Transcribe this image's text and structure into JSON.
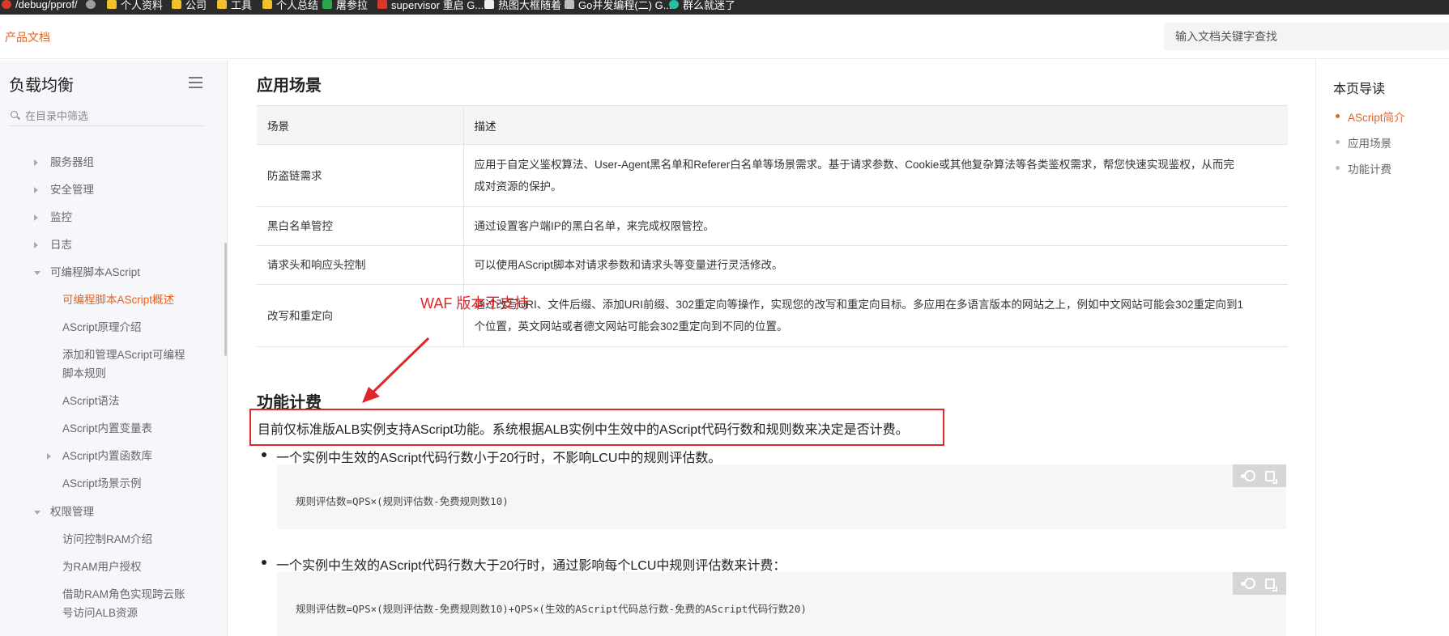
{
  "bookmarks": [
    {
      "label": "/debug/pprof/",
      "color": "#d9382b"
    },
    {
      "label": "",
      "color": "#9e9e9e"
    },
    {
      "label": "个人资料",
      "color": "#f2c12e"
    },
    {
      "label": "公司",
      "color": "#f2c12e"
    },
    {
      "label": "工具",
      "color": "#f2c12e"
    },
    {
      "label": "个人总结",
      "color": "#f2c12e"
    },
    {
      "label": "屠参拉",
      "color": "#2ba84a"
    },
    {
      "label": "supervisor 重启 G...",
      "color": "#d9382b"
    },
    {
      "label": "热图大框随着",
      "color": "#eeeeee"
    },
    {
      "label": "Go并发编程(二) G...",
      "color": "#bdbdbd"
    },
    {
      "label": "群么就迷了",
      "color": "#26c2a8"
    }
  ],
  "header": {
    "brand": "产品文档",
    "search_placeholder": "输入文档关键字查找"
  },
  "sidebar": {
    "title": "负载均衡",
    "filter_placeholder": "在目录中筛选",
    "items": [
      {
        "label": "服务器组"
      },
      {
        "label": "安全管理"
      },
      {
        "label": "监控"
      },
      {
        "label": "日志"
      },
      {
        "label": "可编程脚本AScript"
      },
      {
        "label": "可编程脚本AScript概述"
      },
      {
        "label": "AScript原理介绍"
      },
      {
        "label": "添加和管理AScript可编程"
      },
      {
        "label": "脚本规则"
      },
      {
        "label": "AScript语法"
      },
      {
        "label": "AScript内置变量表"
      },
      {
        "label": "AScript内置函数库"
      },
      {
        "label": "AScript场景示例"
      },
      {
        "label": "权限管理"
      },
      {
        "label": "访问控制RAM介绍"
      },
      {
        "label": "为RAM用户授权"
      },
      {
        "label": "借助RAM角色实现跨云账"
      },
      {
        "label": "号访问ALB资源"
      }
    ]
  },
  "content": {
    "section1_title": "应用场景",
    "table": {
      "headers": [
        "场景",
        "描述"
      ],
      "rows": [
        {
          "scene": "防盗链需求",
          "desc_line1": "应用于自定义鉴权算法、User-Agent黑名单和Referer白名单等场景需求。基于请求参数、Cookie或其他复杂算法等各类鉴权需求，帮您快速实现鉴权，从而完",
          "desc_line2": "成对资源的保护。"
        },
        {
          "scene": "黑白名单管控",
          "desc_line1": "通过设置客户端IP的黑白名单，来完成权限管控。",
          "desc_line2": ""
        },
        {
          "scene": "请求头和响应头控制",
          "desc_line1": "可以使用AScript脚本对请求参数和请求头等变量进行灵活修改。",
          "desc_line2": ""
        },
        {
          "scene": "改写和重定向",
          "desc_line1": "通过改写URI、文件后缀、添加URI前缀、302重定向等操作，实现您的改写和重定向目标。多应用在多语言版本的网站之上，例如中文网站可能会302重定向到1",
          "desc_line2": "个位置，英文网站或者德文网站可能会302重定向到不同的位置。"
        }
      ]
    },
    "annotation": "WAF 版本不支持",
    "section2_title": "功能计费",
    "highlight_text": "目前仅标准版ALB实例支持AScript功能。系统根据ALB实例中生效中的AScript代码行数和规则数来决定是否计费。",
    "bullet1": "一个实例中生效的AScript代码行数小于20行时，不影响LCU中的规则评估数。",
    "code1": "规则评估数=QPS×(规则评估数-免费规则数10)",
    "bullet2": "一个实例中生效的AScript代码行数大于20行时，通过影响每个LCU中规则评估数来计费：",
    "code2": "规则评估数=QPS×(规则评估数-免费规则数10)+QPS×(生效的AScript代码总行数-免费的AScript代码行数20)"
  },
  "toc": {
    "title": "本页导读",
    "items": [
      {
        "label": "AScript简介",
        "active": true
      },
      {
        "label": "应用场景",
        "active": false
      },
      {
        "label": "功能计费",
        "active": false
      }
    ]
  },
  "colors": {
    "accent": "#e6621f",
    "annotation_red": "#e0262a"
  }
}
